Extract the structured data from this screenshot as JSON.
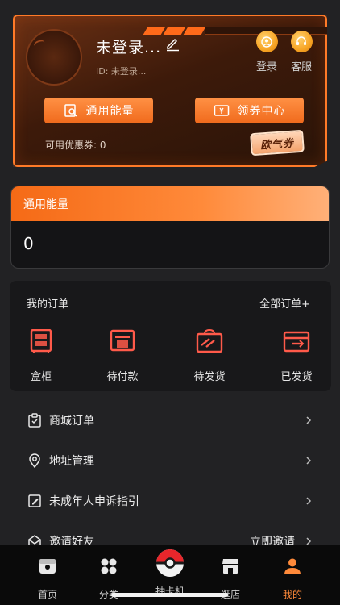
{
  "profile": {
    "username": "未登录...",
    "user_id": "ID: 未登录...",
    "actions": [
      {
        "label": "登录",
        "icon": "user-circle-icon"
      },
      {
        "label": "客服",
        "icon": "headset-icon"
      }
    ],
    "buttons": [
      {
        "label": "通用能量",
        "icon": "energy-search-icon"
      },
      {
        "label": "领券中心",
        "icon": "ticket-icon"
      }
    ],
    "coupon_count": "可用优惠券: 0",
    "coupon_badge": "欧气券"
  },
  "energy": {
    "title": "通用能量",
    "value": "0"
  },
  "orders": {
    "title": "我的订单",
    "all_label": "全部订单+",
    "items": [
      {
        "label": "盒柜",
        "icon": "cabinet-icon"
      },
      {
        "label": "待付款",
        "icon": "pending-payment-icon"
      },
      {
        "label": "待发货",
        "icon": "pending-shipment-icon"
      },
      {
        "label": "已发货",
        "icon": "shipped-icon"
      }
    ]
  },
  "menu": [
    {
      "label": "商城订单",
      "icon": "shop-order-icon",
      "extra": ""
    },
    {
      "label": "地址管理",
      "icon": "location-icon",
      "extra": ""
    },
    {
      "label": "未成年人申诉指引",
      "icon": "edit-doc-icon",
      "extra": ""
    },
    {
      "label": "邀请好友",
      "icon": "invite-icon",
      "extra": "立即邀请"
    }
  ],
  "tabbar": {
    "tabs": [
      {
        "label": "首页",
        "icon": "home-box-icon"
      },
      {
        "label": "分类",
        "icon": "category-icon"
      },
      {
        "label": "抽卡机",
        "icon": "pokeball-icon"
      },
      {
        "label": "逛店",
        "icon": "store-icon"
      },
      {
        "label": "我的",
        "icon": "profile-icon"
      }
    ],
    "active": "我的"
  },
  "colors": {
    "accent": "#ff7a28",
    "background": "#222224",
    "active_tab": "#ff8a3a"
  }
}
